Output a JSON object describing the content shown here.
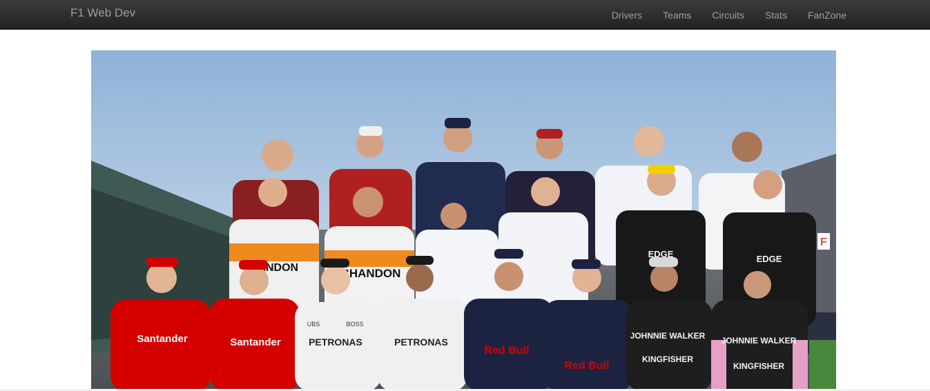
{
  "navbar": {
    "brand": "F1 Web Dev",
    "links": [
      "Drivers",
      "Teams",
      "Circuits",
      "Stats",
      "FanZone"
    ]
  },
  "hero": {
    "image_subject": "Formula 1 driver group photo at the circuit",
    "visible_text": [
      "Santander",
      "HANDON",
      "CHANDON",
      "PETRONAS",
      "Red Bull",
      "EDGE",
      "JOHNNIE WALKER",
      "KINGFISHER",
      "UBS",
      "BOSS",
      "F"
    ]
  },
  "colors": {
    "navbar_dark": "#222222",
    "navbar_text": "#9d9d9d",
    "ferrari_red": "#d40000",
    "mercedes_white": "#f0f0f0",
    "redbull_navy": "#1c2340",
    "forceindia_pink": "#e6a0c8",
    "renault_yellow": "#f2d000",
    "mclaren_orange": "#f0891e",
    "sky": "#b9cde0"
  }
}
